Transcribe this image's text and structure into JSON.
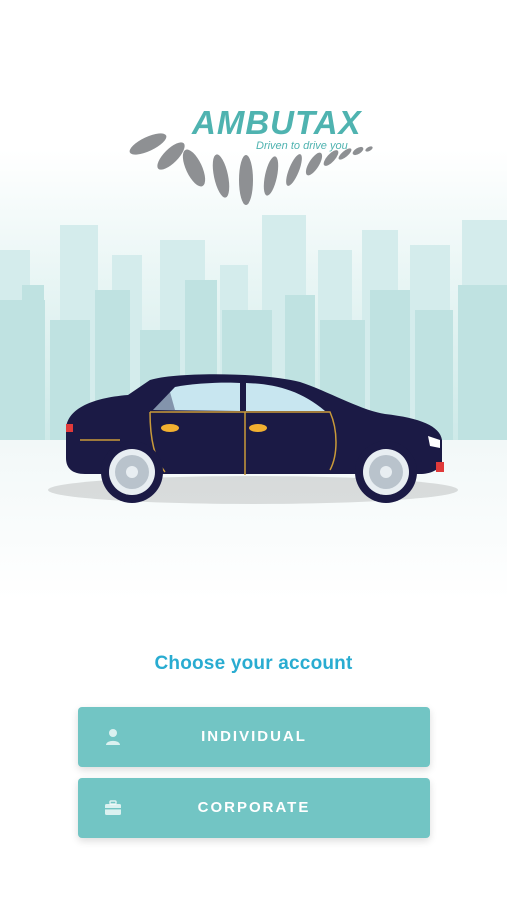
{
  "brand": {
    "name": "AMBUTAX",
    "tagline": "Driven to drive you",
    "logo_icon": "speed-swoosh-icon",
    "accent_color": "#4fb3b0"
  },
  "hero": {
    "illustration": "sedan-car-over-city-skyline",
    "car_color": "#1b1a45",
    "skyline_color": "#cde8e8"
  },
  "account": {
    "title": "Choose your account",
    "title_color": "#29acd1",
    "options": [
      {
        "label": "INDIVIDUAL",
        "icon": "person-icon"
      },
      {
        "label": "CORPORATE",
        "icon": "briefcase-icon"
      }
    ],
    "button_color": "#72c5c4"
  }
}
